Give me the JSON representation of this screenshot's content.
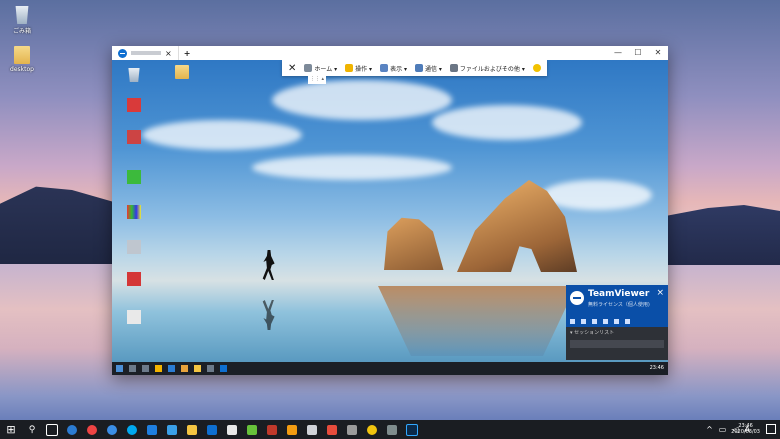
{
  "desktop": {
    "icons": [
      {
        "label": "ごみ箱",
        "icon": "recycle-bin-icon"
      },
      {
        "label": "desktop",
        "icon": "folder-icon"
      }
    ]
  },
  "remote_window": {
    "close_tab": "×",
    "new_tab": "+",
    "controls": {
      "minimize": "—",
      "maximize": "☐",
      "close": "✕"
    }
  },
  "toolbar": {
    "close": "✕",
    "items": [
      {
        "label": "ホーム ▾",
        "icon": "home-icon"
      },
      {
        "label": "操作 ▾",
        "icon": "action-icon"
      },
      {
        "label": "表示 ▾",
        "icon": "view-icon"
      },
      {
        "label": "通信 ▾",
        "icon": "communicate-icon"
      },
      {
        "label": "ファイルおよびその他 ▾",
        "icon": "files-icon"
      }
    ],
    "collapse": "⋮⋮ ▴"
  },
  "teamviewer_panel": {
    "name": "TeamViewer",
    "subtitle": "無料ライセンス（個人使用)",
    "close": "×",
    "sessions_label": "▾ セッションリスト",
    "brand_color": "#0a4fa8"
  },
  "remote_taskbar": {
    "time": "23:46"
  },
  "taskbar": {
    "start": "⊞",
    "search": "⚲",
    "tray_lang": "A",
    "time": "23:46",
    "date": "2020/03/03"
  }
}
